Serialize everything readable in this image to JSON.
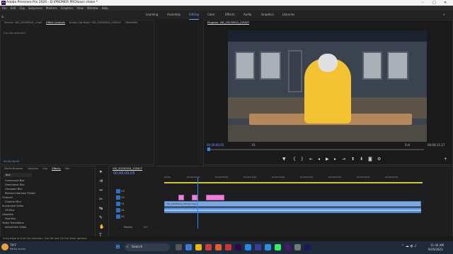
{
  "app": {
    "title": "Adobe Premiere Pro 2020 - D:\\PREMIER PRO\\bass shake *",
    "logo": "Pr"
  },
  "menu": [
    "File",
    "Edit",
    "Clip",
    "Sequence",
    "Markers",
    "Graphics",
    "View",
    "Window",
    "Help"
  ],
  "workspaces": [
    "Learning",
    "Assembly",
    "Editing",
    "Color",
    "Effects",
    "Audio",
    "Graphics",
    "Libraries"
  ],
  "active_workspace": "Editing",
  "source_panel": {
    "tabs": [
      "Source: VID_20230924_..mp4",
      "Effect Controls",
      "Audio Clip Mixer: VID_20230924_155407",
      "Metadata"
    ],
    "active_tab": "Effect Controls",
    "empty_text": "(no clip selected)",
    "timecode": "00;00;00;00"
  },
  "program_panel": {
    "tab": "Program: VID_20230924_155407",
    "timecode": "00;00;00;05",
    "fit": "Fit",
    "quality": "Full",
    "duration": "00;00;11;17"
  },
  "effects_panel": {
    "tabs": [
      "Media Browser",
      "Libraries",
      "Info",
      "Effects",
      "Mar"
    ],
    "active_tab": "Effects",
    "search_value": "blur",
    "items": [
      "Compound Blur",
      "Directional Blur",
      "Gaussian Blur",
      "Reduce Interlace Flicker",
      "Channel",
      "Channel Blur",
      "Immersive Video",
      "VR Blur",
      "Obsolete",
      "Fast Blur",
      "Video Transitions",
      "Immersive Video"
    ]
  },
  "timeline": {
    "tab": "VID_20230924_155407",
    "timecode": "00;00;00;05",
    "ruler": [
      "00;00",
      "00;00;04;00",
      "00;00;08;00",
      "00;00;12;00",
      "00;00;16;00",
      "00;00;20;00",
      "00;00;24;00",
      "00;00;28;00",
      "00;00;32;00"
    ],
    "tracks": [
      "V3",
      "V2",
      "V1",
      "A1",
      "A2"
    ],
    "track_labels": {
      "v3": "V3",
      "v2": "V2",
      "v1": "V1",
      "a1": "A1",
      "a2": "A2"
    },
    "clip_label": "VID_20230924_155407.mp4",
    "master_label": "Master",
    "master_value": "0.0"
  },
  "status_text": "Drag edge to trim the selection. Use Alt and Ctrl for other options.",
  "taskbar": {
    "weather_temp": "79°F",
    "weather_desc": "Partly sunny",
    "search_placeholder": "Search",
    "time": "11:44 AM",
    "date": "9/26/2023"
  },
  "colors": {
    "accent": "#2d8ceb",
    "clip_pink": "#e784d6",
    "clip_blue": "#7ea7dc",
    "hoodie": "#f2c230"
  }
}
